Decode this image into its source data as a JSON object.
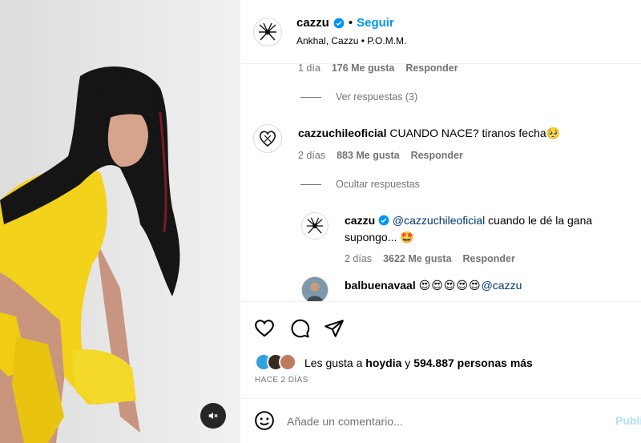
{
  "post": {
    "username": "cazzu",
    "separator": "•",
    "follow_label": "Seguir",
    "audio_artists": "Ankhal, Cazzu",
    "audio_separator": "•",
    "audio_track": "P.O.M.M."
  },
  "comments": {
    "first_meta": {
      "age": "1 día",
      "likes": "176 Me gusta",
      "reply": "Responder"
    },
    "view_replies": "Ver respuestas (3)",
    "second": {
      "username": "cazzuchileoficial",
      "text": "CUANDO NACE? tiranos fecha",
      "emoji": "🥺",
      "age": "2 días",
      "likes": "883 Me gusta",
      "reply": "Responder"
    },
    "hide_replies": "Ocultar respuestas",
    "reply": {
      "username": "cazzu",
      "mention": "@cazzuchileoficial",
      "text_part1": " cuando le dé la gana",
      "text_part2": "supongo...",
      "emoji": "🤩",
      "age": "2 días",
      "likes": "3622 Me gusta",
      "reply": "Responder"
    },
    "third": {
      "username": "balbuenavaal",
      "emojis": "😍😍😍😍😍",
      "mention": "@cazzu"
    }
  },
  "likes": {
    "prefix": "Les gusta a ",
    "first_user": "hoydia",
    "connector": " y ",
    "count": "594.887 personas más"
  },
  "time_ago": "HACE 2 DÍAS",
  "add_comment": {
    "placeholder": "Añade un comentario...",
    "publish": "Publi"
  },
  "colors": {
    "link_blue": "#0095f6",
    "muted": "#737373",
    "publish_disabled": "#b2dffc"
  },
  "icons": [
    "spider-logo-icon",
    "verified-badge-icon",
    "heart-icon",
    "comment-icon",
    "share-icon",
    "emoji-icon",
    "mute-icon"
  ]
}
